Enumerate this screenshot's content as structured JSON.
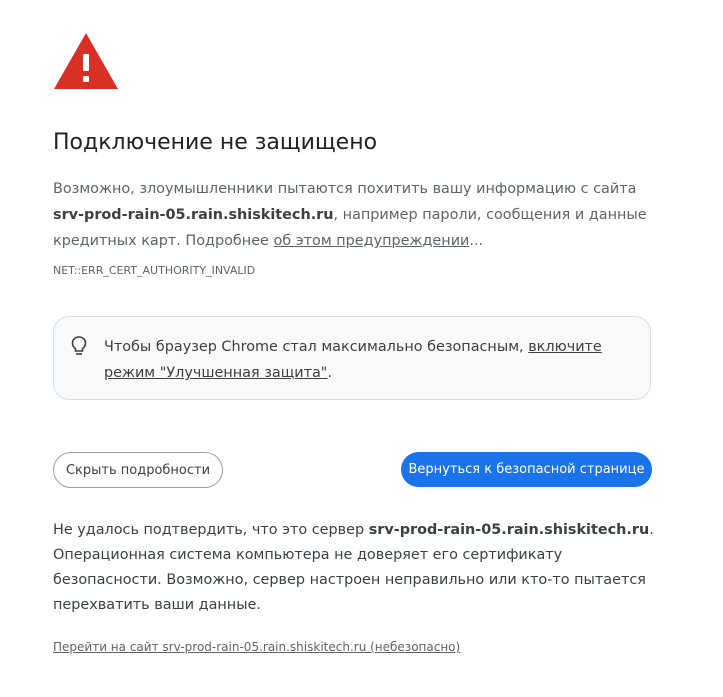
{
  "icons": {
    "warning": "warning-triangle-icon",
    "tip": "lightbulb-icon"
  },
  "colors": {
    "warning_red": "#d93025",
    "primary_blue": "#1a73e8"
  },
  "header": {
    "title": "Подключение не защищено"
  },
  "description": {
    "part1": "Возможно, злоумышленники пытаются похитить вашу информацию с сайта ",
    "host": "srv-prod-rain-05.rain.shiskitech.ru",
    "part2": ", например пароли, сообщения и данные кредитных карт. Подробнее ",
    "link": "об этом предупреждении",
    "part3": "..."
  },
  "error_code": "NET::ERR_CERT_AUTHORITY_INVALID",
  "tip": {
    "text": "Чтобы браузер Chrome стал максимально безопасным, ",
    "link": "включите режим \"Улучшенная защита\"",
    "end": "."
  },
  "buttons": {
    "hide_details": "Скрыть подробности",
    "back_to_safety": "Вернуться к безопасной странице"
  },
  "details": {
    "part1": "Не удалось подтвердить, что это сервер ",
    "host": "srv-prod-rain-05.rain.shiskitech.ru",
    "part2": ". Операционная система компьютера не доверяет его сертификату безопасности. Возможно, сервер настроен неправильно или кто-то пытается перехватить ваши данные."
  },
  "proceed_link": "Перейти на сайт srv-prod-rain-05.rain.shiskitech.ru (небезопасно)"
}
